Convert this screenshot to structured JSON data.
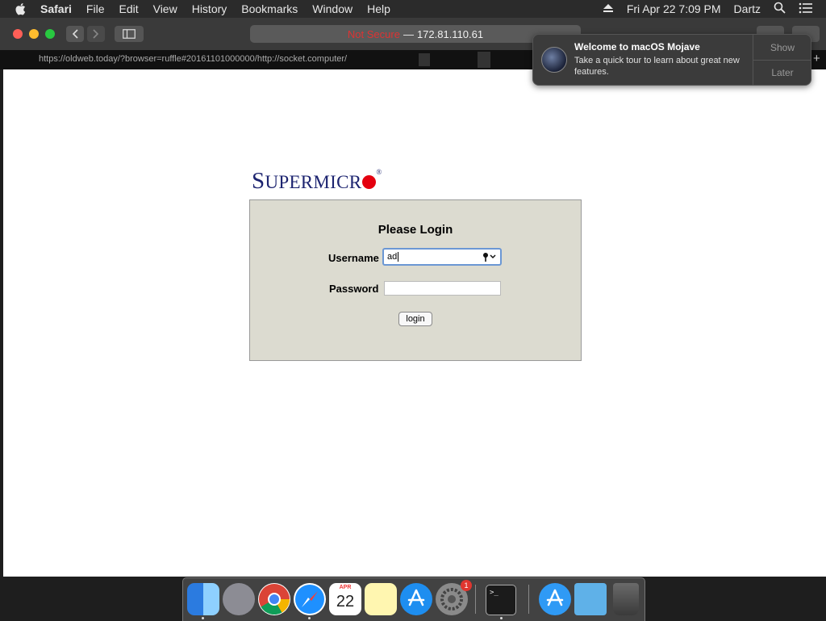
{
  "menubar": {
    "app": "Safari",
    "items": [
      "File",
      "Edit",
      "View",
      "History",
      "Bookmarks",
      "Window",
      "Help"
    ],
    "clock": "Fri Apr 22  7:09 PM",
    "user": "Dartz"
  },
  "browser": {
    "address_warning": "Not Secure",
    "address_separator": "—",
    "address_host": "172.81.110.61",
    "url_strip": "https://oldweb.today/?browser=ruffle#20161101000000/http://socket.computer/"
  },
  "page": {
    "logo_first": "S",
    "logo_rest": "UPERMICR",
    "logo_reg": "®",
    "login_title": "Please Login",
    "username_label": "Username",
    "username_value": "ad",
    "password_label": "Password",
    "login_button": "login"
  },
  "notification": {
    "title": "Welcome to macOS Mojave",
    "body": "Take a quick tour to learn about great new features.",
    "show": "Show",
    "later": "Later"
  },
  "dock": {
    "calendar_month": "APR",
    "calendar_day": "22",
    "prefs_badge": "1",
    "terminal_prompt": ">_"
  },
  "colors": {
    "logo_blue": "#1d2470",
    "logo_red": "#e4000f",
    "login_panel": "#dcdbd0",
    "focus_ring": "#6b97d4"
  },
  "icons": [
    "apple-icon",
    "eject-icon",
    "search-icon",
    "list-icon",
    "back-icon",
    "forward-icon",
    "sidebar-icon",
    "key-icon"
  ]
}
